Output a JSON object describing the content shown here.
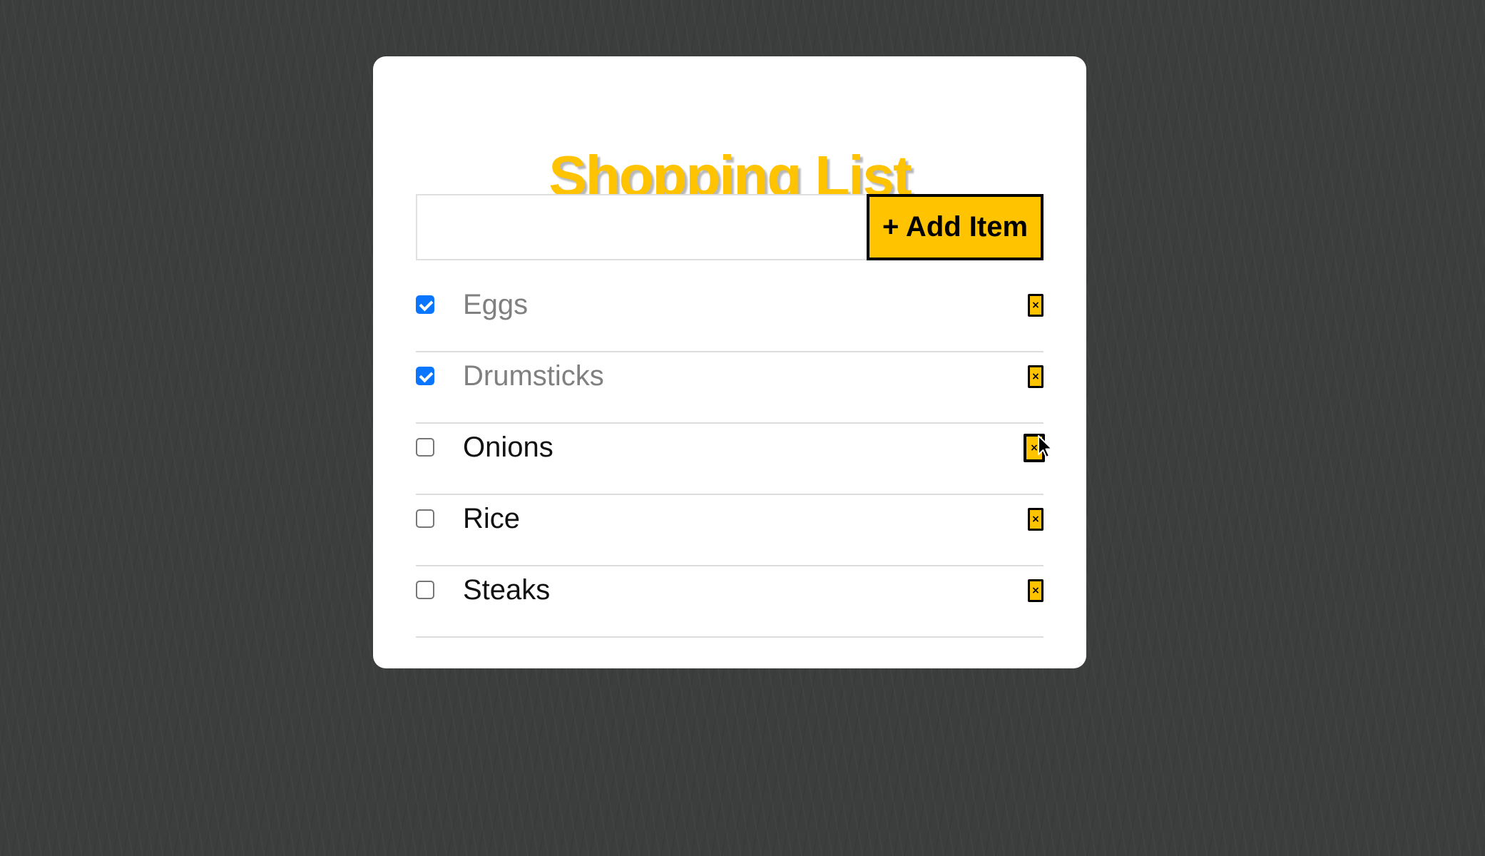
{
  "title": "Shopping List",
  "add_form": {
    "input_value": "",
    "input_placeholder": "",
    "button_label": "+ Add Item"
  },
  "items": [
    {
      "label": "Eggs",
      "checked": true,
      "delete_label": "×"
    },
    {
      "label": "Drumsticks",
      "checked": true,
      "delete_label": "×"
    },
    {
      "label": "Onions",
      "checked": false,
      "delete_label": "×"
    },
    {
      "label": "Rice",
      "checked": false,
      "delete_label": "×"
    },
    {
      "label": "Steaks",
      "checked": false,
      "delete_label": "×"
    }
  ],
  "colors": {
    "accent": "#ffc300",
    "checkbox_checked": "#0a75ff",
    "background": "#3c3d3d",
    "done_text": "#808080"
  },
  "icons": {
    "delete": "close-icon",
    "checkbox_checked": "checkmark-icon",
    "cursor": "mouse-pointer-icon"
  }
}
